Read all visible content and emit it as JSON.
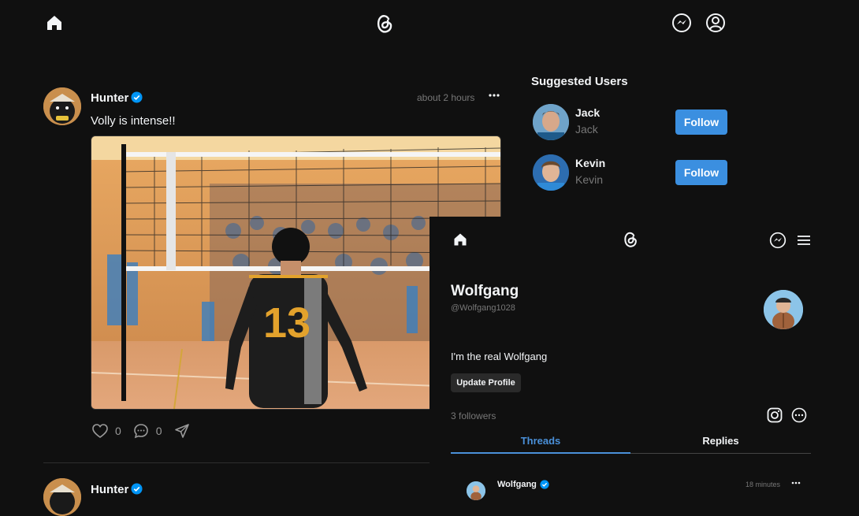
{
  "nav": {
    "home_icon": "home-icon",
    "logo_icon": "threads-logo",
    "messenger_icon": "messenger-icon",
    "profile_icon": "profile-icon"
  },
  "feed": {
    "posts": [
      {
        "username": "Hunter",
        "verified": true,
        "time": "about 2 hours",
        "text": "Volly is intense!!",
        "likes": "0",
        "replies": "0"
      },
      {
        "username": "Hunter",
        "verified": true
      }
    ]
  },
  "suggestions": {
    "title": "Suggested Users",
    "users": [
      {
        "name": "Jack",
        "handle": "Jack",
        "button": "Follow"
      },
      {
        "name": "Kevin",
        "handle": "Kevin",
        "button": "Follow"
      }
    ]
  },
  "profile": {
    "name": "Wolfgang",
    "handle": "@Wolfgang1028",
    "bio": "I'm the real Wolfgang",
    "update_button": "Update Profile",
    "followers": "3 followers",
    "tabs": [
      "Threads",
      "Replies"
    ],
    "active_tab": "Threads",
    "post": {
      "username": "Wolfgang",
      "verified": true,
      "time": "18 minutes"
    }
  },
  "colors": {
    "background": "#101010",
    "accent": "#3b8fe0",
    "verified": "#0095f6",
    "muted": "#777777"
  }
}
